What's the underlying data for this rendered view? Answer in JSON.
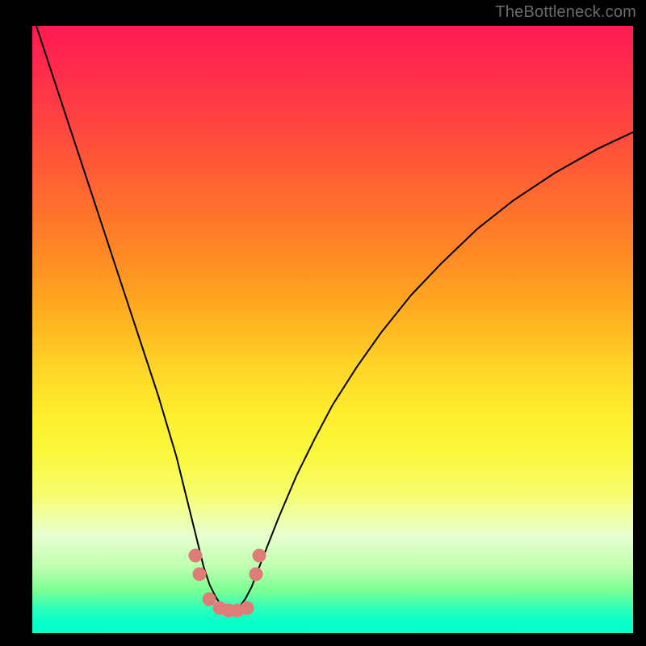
{
  "watermark": "TheBottleneck.com",
  "colors": {
    "background": "#000000",
    "marker": "#e07c78",
    "curve": "#000000"
  },
  "chart_data": {
    "type": "line",
    "title": "",
    "xlabel": "",
    "ylabel": "",
    "xlim": [
      0,
      100
    ],
    "ylim": [
      0,
      100
    ],
    "x": [
      0,
      3,
      6,
      9,
      12,
      15,
      18,
      21,
      24,
      25.5,
      27,
      28.5,
      29.5,
      30.5,
      31.5,
      32.5,
      33.5,
      34.5,
      35.5,
      36.5,
      37.5,
      39,
      41,
      44,
      47,
      50,
      54,
      58,
      63,
      68,
      74,
      80,
      87,
      94,
      100
    ],
    "y": [
      102,
      93,
      84,
      75,
      66,
      57,
      48,
      39,
      29,
      23,
      17,
      11,
      8,
      6,
      4.5,
      3.5,
      3.5,
      4.3,
      5.7,
      7.6,
      10.2,
      14,
      19,
      26,
      32,
      37.6,
      43.8,
      49.4,
      55.6,
      60.8,
      66.5,
      71.2,
      75.8,
      79.7,
      82.5
    ],
    "markers_x": [
      27.2,
      27.8,
      29.5,
      31.2,
      32.6,
      34.1,
      35.7,
      37.2,
      37.8
    ],
    "markers_y": [
      12.8,
      9.7,
      5.6,
      4.1,
      3.7,
      3.7,
      4.1,
      9.7,
      12.8
    ],
    "gradient_stops": [
      {
        "pos": 0,
        "color": "#ff1a52"
      },
      {
        "pos": 18,
        "color": "#ff4a3d"
      },
      {
        "pos": 38,
        "color": "#ff8b24"
      },
      {
        "pos": 56,
        "color": "#ffd426"
      },
      {
        "pos": 70,
        "color": "#fbf73a"
      },
      {
        "pos": 89,
        "color": "#bfffaf"
      },
      {
        "pos": 100,
        "color": "#05ffc9"
      }
    ]
  }
}
